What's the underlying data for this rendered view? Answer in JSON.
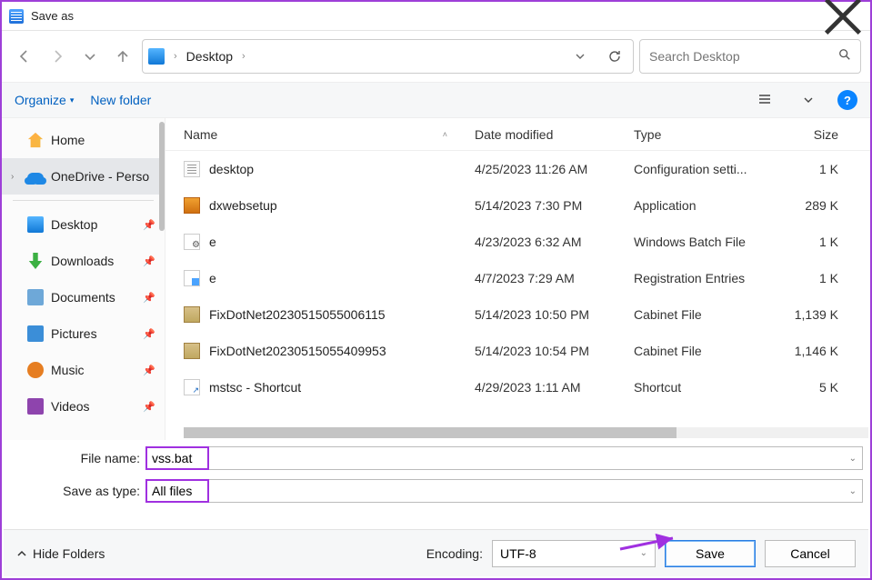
{
  "window": {
    "title": "Save as"
  },
  "nav": {
    "breadcrumb": [
      "Desktop"
    ],
    "search_placeholder": "Search Desktop"
  },
  "toolbar": {
    "organize": "Organize",
    "new_folder": "New folder"
  },
  "sidebar": {
    "home": "Home",
    "onedrive": "OneDrive - Perso",
    "quick": [
      {
        "label": "Desktop"
      },
      {
        "label": "Downloads"
      },
      {
        "label": "Documents"
      },
      {
        "label": "Pictures"
      },
      {
        "label": "Music"
      },
      {
        "label": "Videos"
      }
    ]
  },
  "columns": {
    "name": "Name",
    "date": "Date modified",
    "type": "Type",
    "size": "Size"
  },
  "files": [
    {
      "name": "desktop",
      "date": "4/25/2023 11:26 AM",
      "type": "Configuration setti...",
      "size": "1 K",
      "ico": "cfg"
    },
    {
      "name": "dxwebsetup",
      "date": "5/14/2023 7:30 PM",
      "type": "Application",
      "size": "289 K",
      "ico": "exe"
    },
    {
      "name": "e",
      "date": "4/23/2023 6:32 AM",
      "type": "Windows Batch File",
      "size": "1 K",
      "ico": "bat"
    },
    {
      "name": "e",
      "date": "4/7/2023 7:29 AM",
      "type": "Registration Entries",
      "size": "1 K",
      "ico": "reg"
    },
    {
      "name": "FixDotNet20230515055006115",
      "date": "5/14/2023 10:50 PM",
      "type": "Cabinet File",
      "size": "1,139 K",
      "ico": "cab"
    },
    {
      "name": "FixDotNet20230515055409953",
      "date": "5/14/2023 10:54 PM",
      "type": "Cabinet File",
      "size": "1,146 K",
      "ico": "cab"
    },
    {
      "name": "mstsc - Shortcut",
      "date": "4/29/2023 1:11 AM",
      "type": "Shortcut",
      "size": "5 K",
      "ico": "lnk"
    }
  ],
  "form": {
    "filename_label": "File name:",
    "filename_value": "vss.bat",
    "savetype_label": "Save as type:",
    "savetype_value": "All files"
  },
  "footer": {
    "hide_folders": "Hide Folders",
    "encoding_label": "Encoding:",
    "encoding_value": "UTF-8",
    "save": "Save",
    "cancel": "Cancel"
  }
}
